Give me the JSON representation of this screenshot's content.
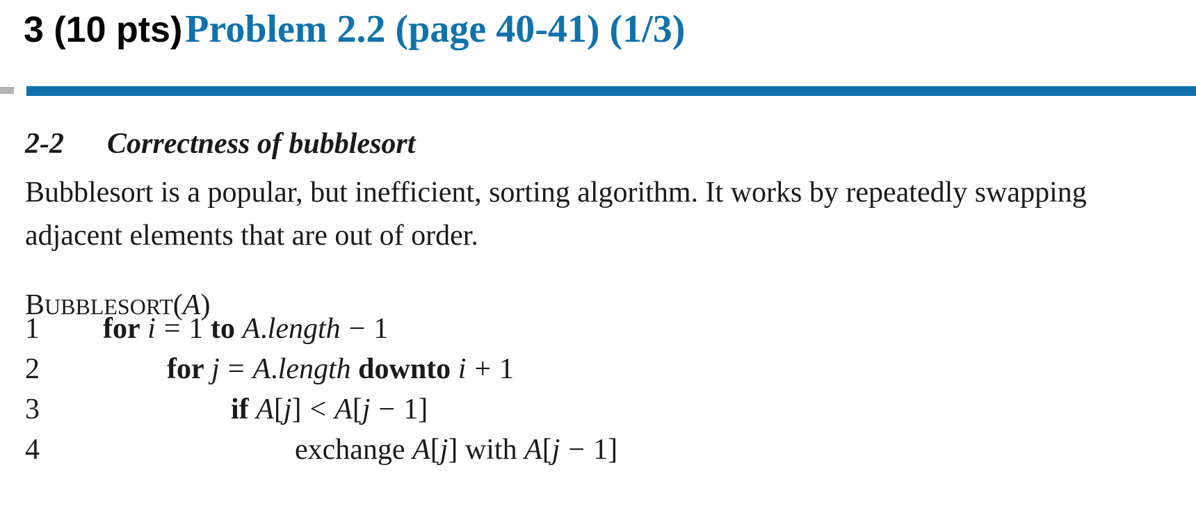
{
  "slide": {
    "title_prefix": "3 (10 pts)",
    "title_main": "Problem 2.2 (page 40-41) (1/3)"
  },
  "problem": {
    "number": "2-2",
    "title": "Correctness of bubblesort",
    "body": "Bubblesort is a popular, but inefficient, sorting algorithm. It works by repeatedly swapping adjacent elements that are out of order."
  },
  "algorithm": {
    "name_initial": "B",
    "name_rest": "UBBLESORT",
    "param_open": "(",
    "param": "A",
    "param_close": ")",
    "lines": [
      {
        "number": "1",
        "kw_for": "for",
        "var": "i",
        "eq": "=",
        "start": "1",
        "kw_to": "to",
        "bound_obj": "A",
        "bound_dot": ".",
        "bound_attr": "length",
        "minus": "−",
        "one": "1"
      },
      {
        "number": "2",
        "kw_for": "for",
        "var": "j",
        "eq": "=",
        "start_obj": "A",
        "start_dot": ".",
        "start_attr": "length",
        "kw_downto": "downto",
        "end_var": "i",
        "plus": "+",
        "one": "1"
      },
      {
        "number": "3",
        "kw_if": "if",
        "lhs_arr": "A",
        "lhs_idx_open": "[",
        "lhs_idx": "j",
        "lhs_idx_close": "]",
        "lt": "<",
        "rhs_arr": "A",
        "rhs_idx_open": "[",
        "rhs_idx": "j",
        "minus": "−",
        "one": "1",
        "rhs_idx_close": "]"
      },
      {
        "number": "4",
        "verb": "exchange",
        "a_arr": "A",
        "a_open": "[",
        "a_idx": "j",
        "a_close": "]",
        "with": "with",
        "b_arr": "A",
        "b_open": "[",
        "b_idx": "j",
        "minus": "−",
        "one": "1",
        "b_close": "]"
      }
    ]
  },
  "colors": {
    "accent": "#1172ab",
    "stub": "#b3b3b3",
    "text": "#1a1a1a"
  }
}
